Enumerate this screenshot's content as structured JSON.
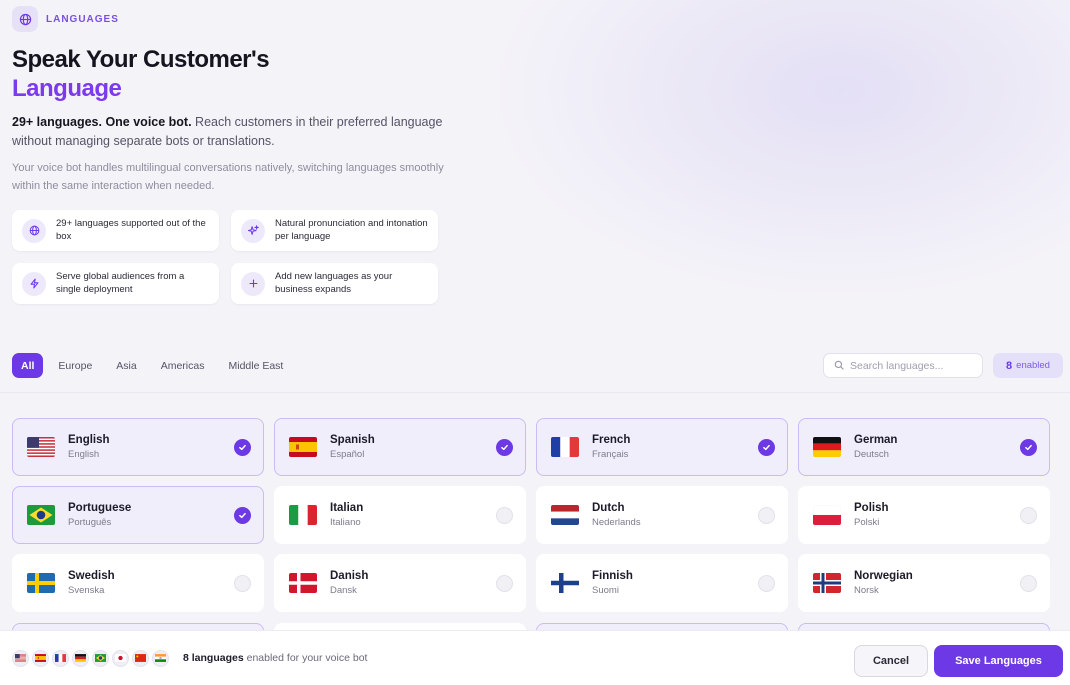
{
  "hero": {
    "tag": "LANGUAGES",
    "tag_icon": "globe-icon",
    "title_line1": "Speak Your Customer's",
    "title_line2": "Language",
    "lead_bold": "29+ languages. One voice bot.",
    "lead_rest": " Reach customers in their preferred language without managing separate bots or translations.",
    "sub": "Your voice bot handles multilingual conversations natively, switching languages smoothly within the same interaction when needed."
  },
  "features": [
    {
      "icon": "globe-icon",
      "text": "29+ languages supported out of the box"
    },
    {
      "icon": "sparkle-icon",
      "text": "Natural pronunciation and intonation per language"
    },
    {
      "icon": "lightning-icon",
      "text": "Serve global audiences from a single deployment"
    },
    {
      "icon": "plus-icon",
      "text": "Add new languages as your business expands"
    }
  ],
  "filters": [
    "All",
    "Europe",
    "Asia",
    "Americas",
    "Middle East"
  ],
  "active_filter": "All",
  "search": {
    "placeholder": "Search languages..."
  },
  "enabled_badge": {
    "count": "8",
    "label": "enabled"
  },
  "languages": [
    {
      "name": "English",
      "native": "English",
      "flag": "us",
      "enabled": true
    },
    {
      "name": "Spanish",
      "native": "Español",
      "flag": "es",
      "enabled": true
    },
    {
      "name": "French",
      "native": "Français",
      "flag": "fr",
      "enabled": true
    },
    {
      "name": "German",
      "native": "Deutsch",
      "flag": "de",
      "enabled": true
    },
    {
      "name": "Portuguese",
      "native": "Português",
      "flag": "br",
      "enabled": true
    },
    {
      "name": "Italian",
      "native": "Italiano",
      "flag": "it",
      "enabled": false
    },
    {
      "name": "Dutch",
      "native": "Nederlands",
      "flag": "nl",
      "enabled": false
    },
    {
      "name": "Polish",
      "native": "Polski",
      "flag": "pl",
      "enabled": false
    },
    {
      "name": "Swedish",
      "native": "Svenska",
      "flag": "se",
      "enabled": false
    },
    {
      "name": "Danish",
      "native": "Dansk",
      "flag": "dk",
      "enabled": false
    },
    {
      "name": "Finnish",
      "native": "Suomi",
      "flag": "fi",
      "enabled": false
    },
    {
      "name": "Norwegian",
      "native": "Norsk",
      "flag": "no",
      "enabled": false
    }
  ],
  "partial_row_enabled": [
    true,
    false,
    true,
    true
  ],
  "footer": {
    "mini_flags": [
      "us",
      "es",
      "fr",
      "de",
      "br",
      "jp",
      "cn",
      "in"
    ],
    "count_text": "8 languages",
    "suffix_text": " enabled for your voice bot",
    "cancel_label": "Cancel",
    "save_label": "Save Languages"
  },
  "colors": {
    "accent": "#6d38e6",
    "accent_soft": "#f1eefc"
  }
}
